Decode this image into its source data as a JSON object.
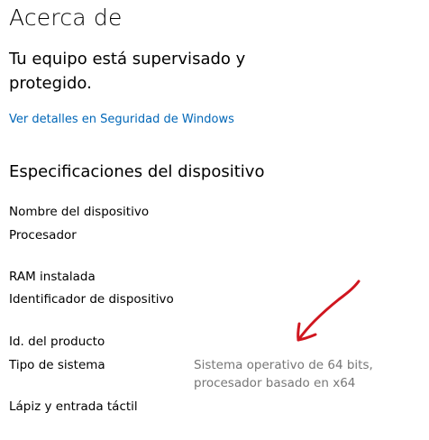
{
  "page": {
    "title": "Acerca de"
  },
  "protection": {
    "status_text": "Tu equipo está supervisado y protegido.",
    "link_label": "Ver detalles en Seguridad de Windows"
  },
  "specs": {
    "heading": "Especificaciones del dispositivo",
    "rows": {
      "device_name": {
        "label": "Nombre del dispositivo"
      },
      "processor": {
        "label": "Procesador"
      },
      "ram": {
        "label": "RAM instalada"
      },
      "device_id": {
        "label": "Identificador de dispositivo"
      },
      "product_id": {
        "label": "Id. del producto"
      },
      "system_type": {
        "label": "Tipo de sistema",
        "value_line1": "Sistema operativo de 64 bits,",
        "value_line2": "procesador basado en x64"
      },
      "pen_touch": {
        "label": "Lápiz y entrada táctil"
      }
    }
  },
  "annotation": {
    "arrow_color": "#d0161f",
    "icon": "hand-drawn-arrow"
  }
}
